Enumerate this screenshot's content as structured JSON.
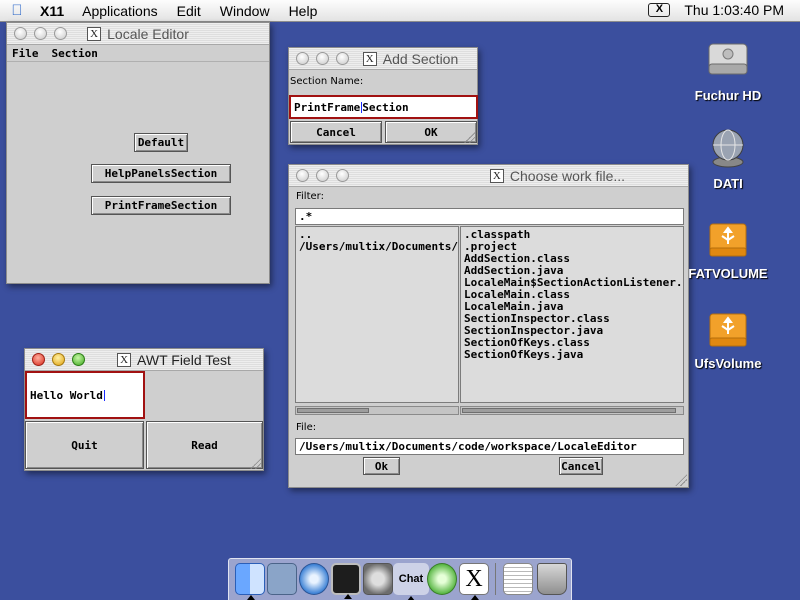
{
  "menubar": {
    "app_name": "X11",
    "menus": [
      "Applications",
      "Edit",
      "Window",
      "Help"
    ],
    "clock": "Thu 1:03:40 PM",
    "x_badge": "X"
  },
  "locale_editor": {
    "title": "Locale Editor",
    "menus": [
      "File",
      "Section"
    ],
    "buttons": [
      "Default",
      "HelpPanelsSection",
      "PrintFrameSection"
    ]
  },
  "add_section": {
    "title": "Add Section",
    "label": "Section Name:",
    "value_before_caret": "PrintFrame",
    "value_after_caret": "Section",
    "cancel": "Cancel",
    "ok": "OK"
  },
  "choose_file": {
    "title": "Choose work file...",
    "filter_label": "Filter:",
    "filter_value": ".*",
    "dirs": [
      "..",
      "/Users/multix/Documents/code/workspace/LocaleEditor"
    ],
    "files": [
      ".classpath",
      ".project",
      "AddSection.class",
      "AddSection.java",
      "LocaleMain$SectionActionListener.class",
      "LocaleMain.class",
      "LocaleMain.java",
      "SectionInspector.class",
      "SectionInspector.java",
      "SectionOfKeys.class",
      "SectionOfKeys.java"
    ],
    "file_label": "File:",
    "file_value": "/Users/multix/Documents/code/workspace/LocaleEditor",
    "ok": "Ok",
    "cancel": "Cancel"
  },
  "awt_test": {
    "title": "AWT Field Test",
    "text_value": "Hello World",
    "quit": "Quit",
    "read": "Read"
  },
  "desktop_icons": [
    {
      "label": "Fuchur HD",
      "icon": "hard-drive-icon"
    },
    {
      "label": "DATI",
      "icon": "network-globe-icon"
    },
    {
      "label": "FATVOLUME",
      "icon": "usb-drive-icon"
    },
    {
      "label": "UfsVolume",
      "icon": "usb-drive-icon"
    }
  ],
  "dock": {
    "chat_label": "Chat",
    "items": [
      "finder-icon",
      "mail-icon",
      "safari-icon",
      "terminal-icon",
      "disk-utility-icon",
      "ichat-icon",
      "itunes-icon",
      "x11-icon",
      "preview-icon",
      "trash-icon"
    ]
  },
  "colors": {
    "desktop": "#3b4f9e",
    "focus_border": "#a11111"
  }
}
